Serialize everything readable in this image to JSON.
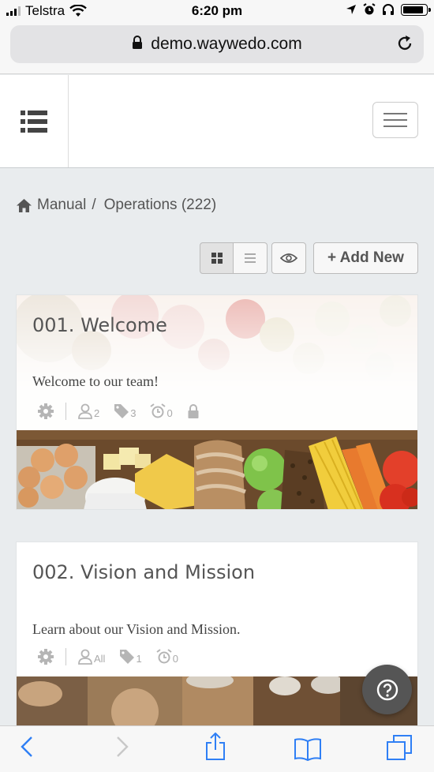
{
  "status_bar": {
    "carrier": "Telstra",
    "time": "6:20 pm"
  },
  "browser": {
    "url": "demo.waywedo.com"
  },
  "breadcrumb": {
    "root": "Manual",
    "separator": "/",
    "current": "Operations (222)"
  },
  "toolbar": {
    "add_new_label": "+ Add New"
  },
  "cards": [
    {
      "title": "001. Welcome",
      "description": "Welcome to our team!",
      "meta": {
        "users": "2",
        "tags": "3",
        "alarms": "0"
      }
    },
    {
      "title": "002. Vision and Mission",
      "description": "Learn about our Vision and Mission.",
      "meta": {
        "users": "All",
        "tags": "1",
        "alarms": "0"
      }
    }
  ],
  "colors": {
    "accent_blue": "#2f7ff5",
    "text_gray": "#555555",
    "meta_gray": "#aaaaaa",
    "page_bg": "#e9ecee"
  }
}
